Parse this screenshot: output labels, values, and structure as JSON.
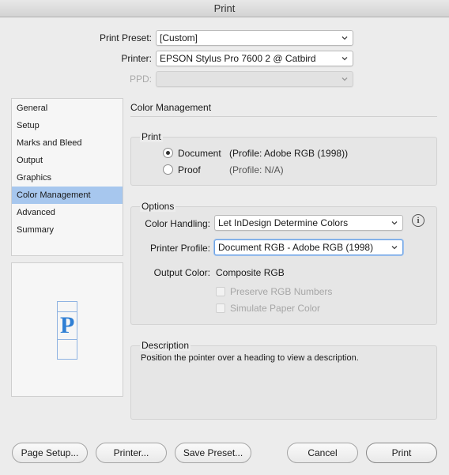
{
  "window": {
    "title": "Print"
  },
  "top": {
    "preset_label": "Print Preset:",
    "preset_value": "[Custom]",
    "printer_label": "Printer:",
    "printer_value": "EPSON Stylus Pro 7600 2 @ Catbird",
    "ppd_label": "PPD:",
    "ppd_value": ""
  },
  "sidebar": {
    "items": [
      {
        "label": "General"
      },
      {
        "label": "Setup"
      },
      {
        "label": "Marks and Bleed"
      },
      {
        "label": "Output"
      },
      {
        "label": "Graphics"
      },
      {
        "label": "Color Management"
      },
      {
        "label": "Advanced"
      },
      {
        "label": "Summary"
      }
    ],
    "selected": "Color Management"
  },
  "preview": {
    "glyph": "P"
  },
  "panel": {
    "title": "Color Management",
    "print_group": {
      "title": "Print",
      "document_label": "Document",
      "document_profile": "(Profile: Adobe RGB (1998))",
      "proof_label": "Proof",
      "proof_profile": "(Profile: N/A)",
      "selected": "Document"
    },
    "options_group": {
      "title": "Options",
      "color_handling_label": "Color Handling:",
      "color_handling_value": "Let InDesign Determine Colors",
      "printer_profile_label": "Printer Profile:",
      "printer_profile_value": "Document RGB - Adobe RGB (1998)",
      "output_color_label": "Output Color:",
      "output_color_value": "Composite RGB",
      "preserve_rgb_label": "Preserve RGB Numbers",
      "simulate_paper_label": "Simulate Paper Color"
    },
    "description_group": {
      "title": "Description",
      "text": "Position the pointer over a heading to view a description."
    }
  },
  "buttons": {
    "page_setup": "Page Setup...",
    "printer": "Printer...",
    "save_preset": "Save Preset...",
    "cancel": "Cancel",
    "print": "Print"
  },
  "icons": {
    "info": "info-icon",
    "chevron": "chevron-down-icon"
  },
  "colors": {
    "selection": "#a7c7ee",
    "focus_ring": "#6ea3e4"
  }
}
